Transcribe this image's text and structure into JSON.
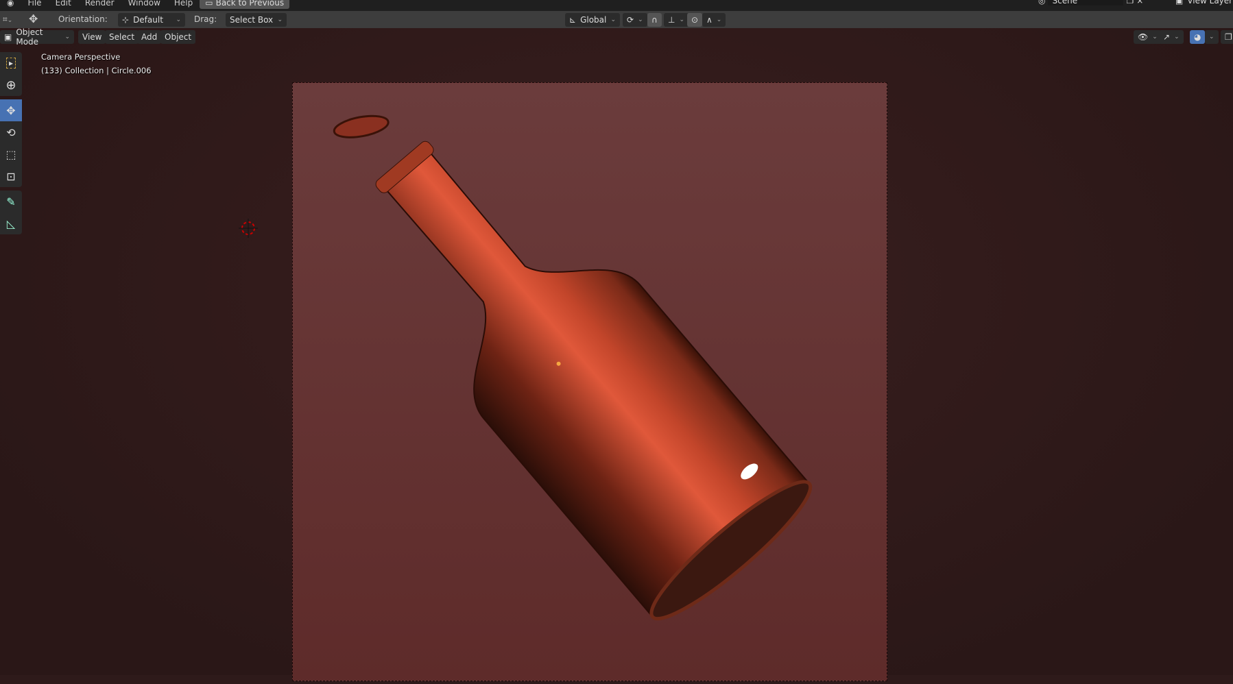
{
  "menu": {
    "items": [
      "File",
      "Edit",
      "Render",
      "Window",
      "Help"
    ],
    "back_button": "Back to Previous"
  },
  "scene": {
    "name": "Scene",
    "view_layer": "View Layer"
  },
  "tool_header": {
    "orientation_label": "Orientation:",
    "orientation_value": "Default",
    "drag_label": "Drag:",
    "drag_value": "Select Box",
    "transform_orientation": "Global"
  },
  "viewport_header": {
    "mode": "Object Mode",
    "menus": [
      "View",
      "Select",
      "Add",
      "Object"
    ]
  },
  "overlay": {
    "view_name": "Camera Perspective",
    "info": "(133) Collection | Circle.006"
  },
  "toolbar": {
    "tools": [
      "select-box",
      "cursor",
      "move",
      "rotate",
      "scale",
      "transform",
      "annotate",
      "measure"
    ],
    "active": "move"
  },
  "colors": {
    "accent": "#4772b3",
    "bottle": "#c2452a",
    "camera_bg": "#6b3c3c"
  }
}
